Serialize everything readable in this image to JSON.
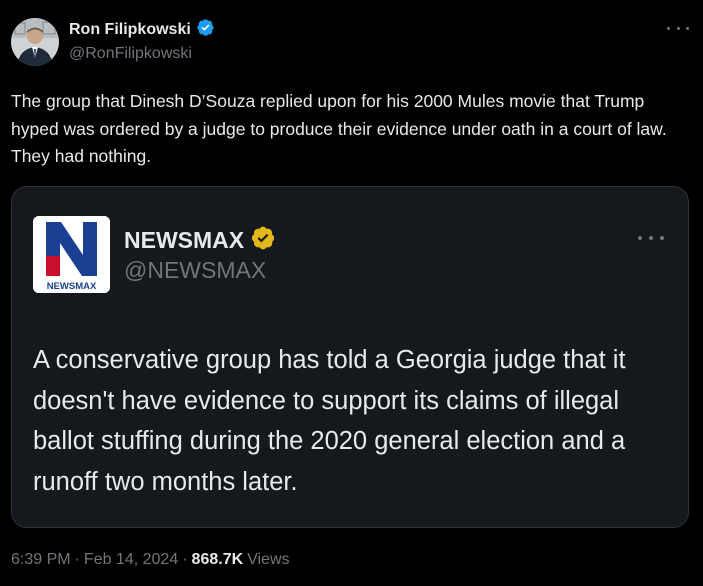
{
  "tweet": {
    "author": {
      "name": "Ron Filipkowski",
      "handle": "@RonFilipkowski",
      "verified": true,
      "verified_color": "#1d9bf0"
    },
    "text": "The group that Dinesh D’Souza replied upon for his 2000 Mules movie that Trump hyped was ordered by a judge to produce their evidence under oath in a court of law. They had nothing.",
    "more_icon": "more-horizontal-icon",
    "quote": {
      "author": {
        "name": "NEWSMAX",
        "handle": "@NEWSMAX",
        "verified": true,
        "verified_color": "#e2b719"
      },
      "logo": {
        "letter": "N",
        "caption": "NEWSMAX",
        "letter_color": "#1b3f93",
        "accent_color": "#c8102e"
      },
      "text": "A conservative group has told a Georgia judge that it doesn't have evidence to support its claims of illegal ballot stuffing during the 2020 general election and a runoff two months later.",
      "more_icon": "more-horizontal-icon"
    },
    "meta": {
      "time": "6:39 PM",
      "separator": "·",
      "date": "Feb 14, 2024",
      "views_count": "868.7K",
      "views_label": "Views"
    }
  }
}
